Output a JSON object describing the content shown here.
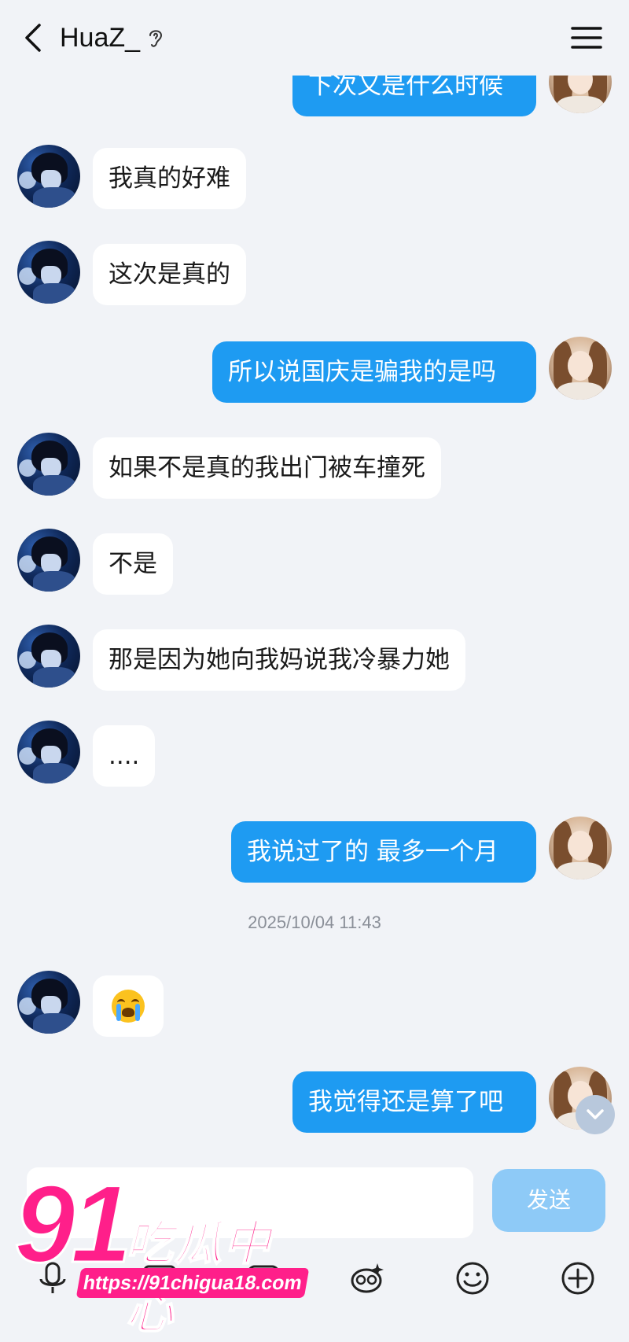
{
  "header": {
    "title": "HuaZ_"
  },
  "messages": [
    {
      "side": "self",
      "text": "下次又是什么时候"
    },
    {
      "side": "other",
      "text": "我真的好难"
    },
    {
      "side": "other",
      "text": "这次是真的"
    },
    {
      "side": "self",
      "text": "所以说国庆是骗我的是吗"
    },
    {
      "side": "other",
      "text": "如果不是真的我出门被车撞死"
    },
    {
      "side": "other",
      "text": "不是"
    },
    {
      "side": "other",
      "text": "那是因为她向我妈说我冷暴力她"
    },
    {
      "side": "other",
      "text": "...."
    },
    {
      "side": "self",
      "text": "我说过了的 最多一个月"
    },
    {
      "side": "other",
      "emoji": "loudly-crying-face"
    },
    {
      "side": "self",
      "text": "我觉得还是算了吧"
    }
  ],
  "timestamp": "2025/10/04 11:43",
  "composer": {
    "send_label": "发送",
    "input_value": "",
    "toolbar_icons": [
      "voice-icon",
      "image-icon",
      "gif-icon",
      "emoji-icon",
      "plus-icon"
    ]
  },
  "watermark": {
    "number": "91",
    "name": "吃瓜中心",
    "url": "https://91chigua18.com"
  },
  "colors": {
    "background": "#f1f3f7",
    "self_bubble": "#1e9bf2",
    "other_bubble": "#ffffff",
    "send_button": "#8ecaf7",
    "watermark": "#ff1f8a"
  }
}
